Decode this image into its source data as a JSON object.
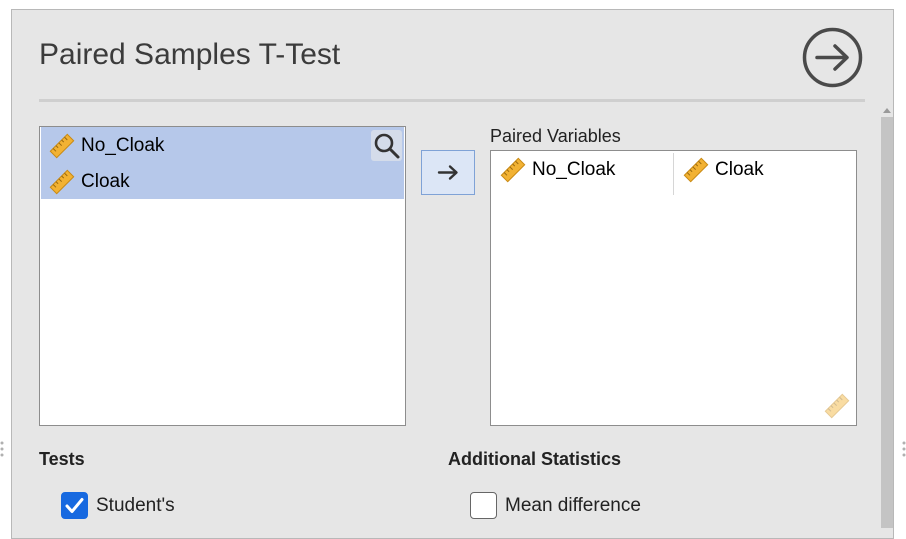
{
  "analysis": {
    "title": "Paired Samples T-Test"
  },
  "available_variables": {
    "items": [
      {
        "label": "No_Cloak",
        "icon": "ruler-icon",
        "selected": true
      },
      {
        "label": "Cloak",
        "icon": "ruler-icon",
        "selected": true
      }
    ],
    "search_icon": "search-icon"
  },
  "assign_button": {
    "icon": "arrow-right-icon"
  },
  "paired_variables": {
    "label": "Paired Variables",
    "pairs": [
      {
        "first": "No_Cloak",
        "second": "Cloak"
      }
    ]
  },
  "tests": {
    "heading": "Tests",
    "options": [
      {
        "label": "Student's",
        "checked": true
      }
    ]
  },
  "additional_statistics": {
    "heading": "Additional Statistics",
    "options": [
      {
        "label": "Mean difference",
        "checked": false
      }
    ]
  },
  "colors": {
    "selection": "#b6c8ea",
    "accent": "#1769e0",
    "ruler": "#e8a92b",
    "panel": "#e6e6e6"
  }
}
